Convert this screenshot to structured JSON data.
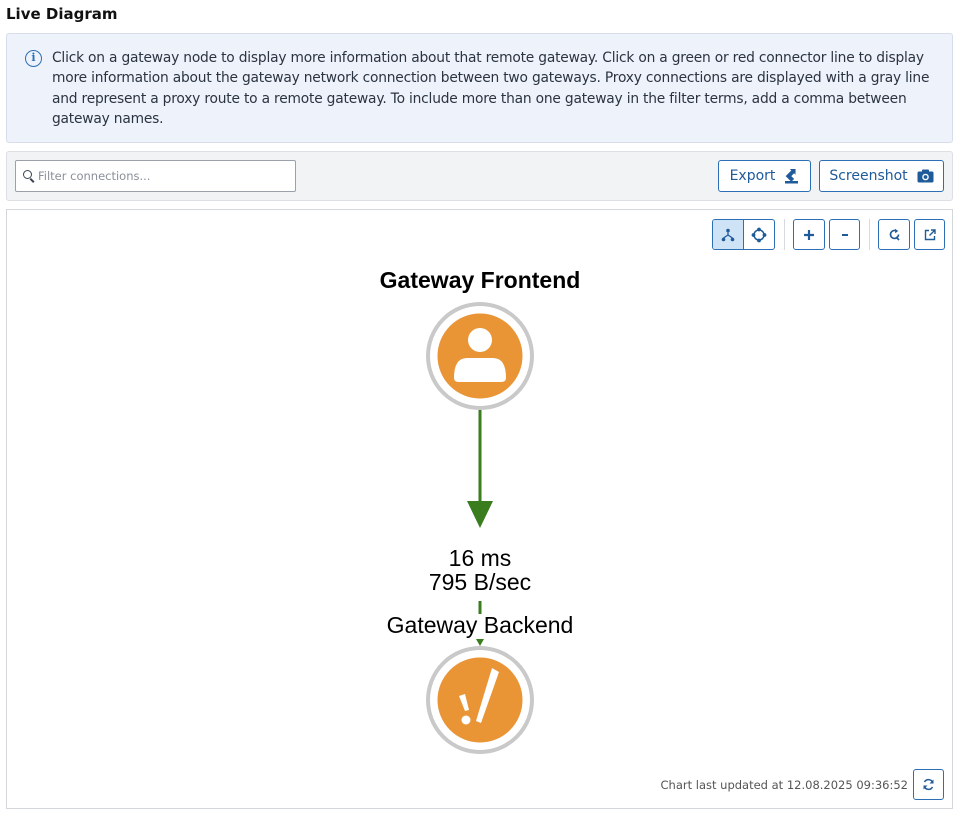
{
  "page": {
    "title": "Live Diagram"
  },
  "info": {
    "icon": "info-icon",
    "text": "Click on a gateway node to display more information about that remote gateway. Click on a green or red connector line to display more information about the gateway network connection between two gateways. Proxy connections are displayed with a gray line and represent a proxy route to a remote gateway. To include more than one gateway in the filter terms, add a comma between gateway names."
  },
  "toolbar": {
    "filter_placeholder": "Filter connections...",
    "filter_value": "",
    "export_label": "Export",
    "screenshot_label": "Screenshot"
  },
  "diagram": {
    "controls": [
      "hierarchy-layout-icon",
      "radial-layout-icon",
      "zoom-in-icon",
      "zoom-out-icon",
      "reset-view-icon",
      "open-external-icon"
    ],
    "source_gateway": {
      "name": "Gateway Frontend",
      "icon": "user-icon",
      "color": "#e99536"
    },
    "connection": {
      "latency": "16 ms",
      "throughput": "795 B/sec",
      "color": "#3a7d1f"
    },
    "target_gateway": {
      "name": "Gateway Backend",
      "icon": "alert-icon",
      "color": "#e99536"
    },
    "last_updated": "Chart last updated at 12.08.2025 09:36:52"
  },
  "colors": {
    "accent": "#2c6fb7",
    "info_bg": "#eef2fa",
    "node": "#e99536",
    "link": "#3a7d1f"
  }
}
